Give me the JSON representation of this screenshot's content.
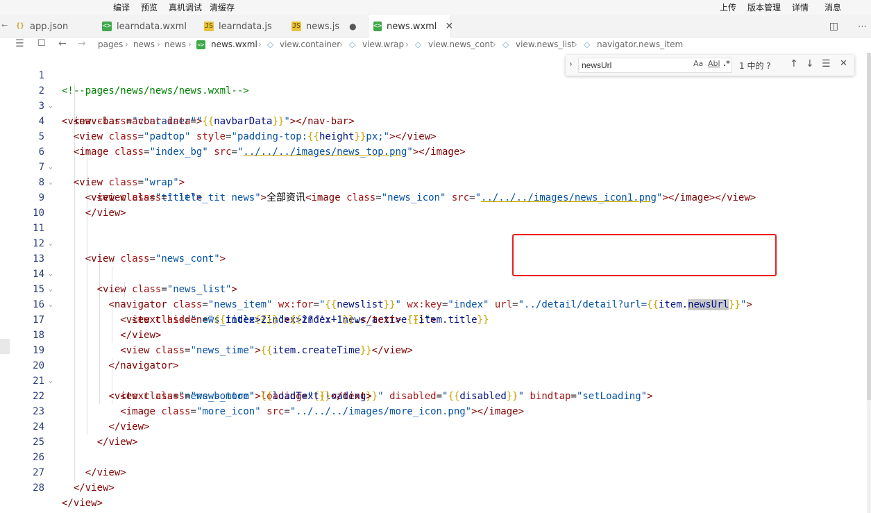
{
  "toolbar": {
    "left": [
      "编译",
      "预览",
      "真机调试",
      "清缓存"
    ],
    "right": [
      "上传",
      "版本管理",
      "详情",
      "消息"
    ]
  },
  "tabs": [
    {
      "label": "app.json",
      "type": "json"
    },
    {
      "label": "learndata.wxml",
      "type": "wxml"
    },
    {
      "label": "learndata.js",
      "type": "js"
    },
    {
      "label": "news.js",
      "type": "js"
    },
    {
      "label": "news.wxml",
      "type": "wxml"
    }
  ],
  "breadcrumb": [
    "pages",
    "news",
    "news",
    "news.wxml",
    "view.container",
    "view.wrap",
    "view.news_cont",
    "view.news_list",
    "navigator.news_item"
  ],
  "find": {
    "query": "newsUrl",
    "case_label": "Aa",
    "word_label": "Abl",
    "regex_label": ".*",
    "result": "1 中的 ?"
  },
  "line_numbers": [
    "1",
    "2",
    "3",
    "4",
    "5",
    "6",
    "7",
    "8",
    "9",
    "10",
    "11",
    "12",
    "13",
    "14",
    "15",
    "16",
    "17",
    "18",
    "19",
    "20",
    "21",
    "22",
    "23",
    "24",
    "25",
    "26",
    "27",
    "28"
  ],
  "lines": [
    "<!--pages/news/news/news.wxml-->",
    "<view class=\"container\">",
    "  <nav-bar navbar-data=\"{{navbarData}}\"></nav-bar>",
    "  <view class=\"padtop\" style=\"padding-top:{{height}}px;\"></view>",
    "  <image class=\"index_bg\" src=\"../../../images/news_top.png\"></image>",
    "  <view class=\"wrap\">",
    "    <view class=\"title\">",
    "      <view class=\"title_tit news\">全部资讯<image class=\"news_icon\" src=\"../../../images/news_icon1.png\"></image></view>",
    "    </view>",
    "",
    "    <view class=\"news_cont\">",
    "",
    "      <view class=\"news_list\">",
    "        <navigator class=\"news_item\" wx:for=\"{{newslist}}\" wx:key=\"index\" url=\"../detail/detail?url={{item.newsUrl}}\">",
    "          <view class=\"news_title{{index>2?'':' news_active'}}\">",
    "            <text hidden=\"{{index>2}}\">{{index+1}}.</text> {{item.title}}",
    "          </view>",
    "          <view class=\"news_time\">{{item.createTime}}</view>",
    "        </navigator>",
    "        <view class=\"news_bottom\" loading=\"{{loading}}\" disabled=\"{{disabled}}\" bindtap=\"setLoading\">",
    "          <text class=\"news_more\">{{loadText}}</text>",
    "          <image class=\"more_icon\" src=\"../../../images/more_icon.png\"></image>",
    "        </view>",
    "      </view>",
    "",
    "    </view>",
    "  </view>",
    "</view>"
  ]
}
